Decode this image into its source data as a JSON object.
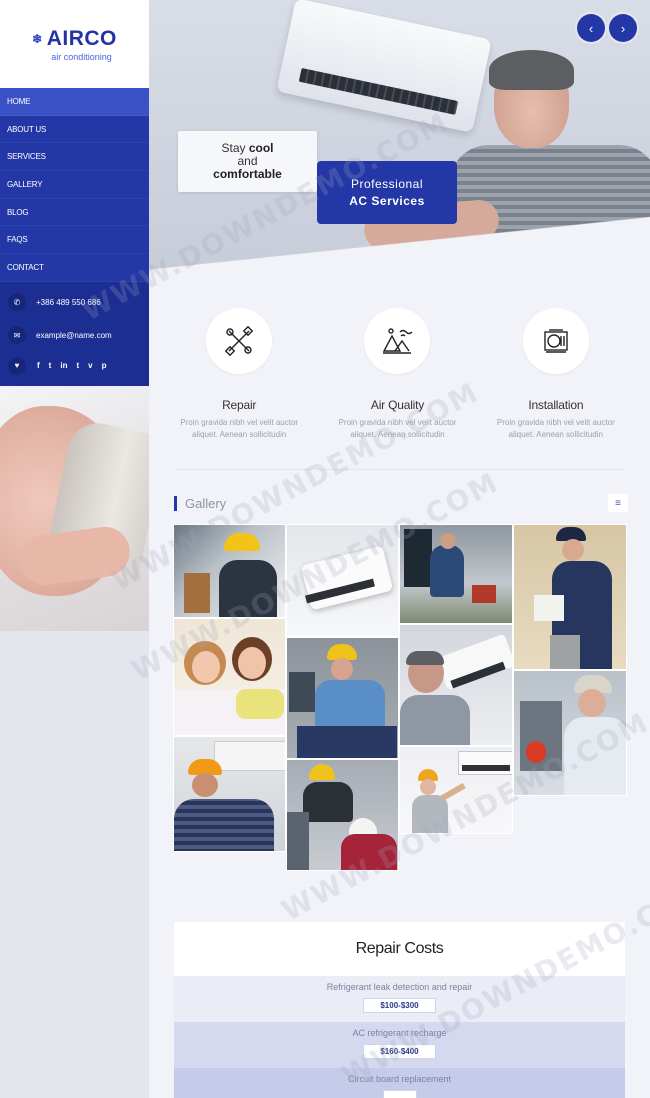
{
  "brand": {
    "name": "AIRCO",
    "tagline": "air conditioning",
    "accent": "#2338a6"
  },
  "nav": {
    "items": [
      "HOME",
      "ABOUT US",
      "SERVICES",
      "GALLERY",
      "BLOG",
      "FAQS",
      "CONTACT"
    ],
    "active": "HOME"
  },
  "contact": {
    "phone": "+386 489 550 686",
    "email": "example@name.com",
    "social_icons": [
      "heart-icon",
      "facebook-icon",
      "twitter-icon",
      "linkedin-icon",
      "tumblr-icon",
      "vimeo-icon",
      "pinterest-icon"
    ],
    "social_glyphs": [
      "f",
      "t",
      "in",
      "t",
      "v",
      "p"
    ]
  },
  "hero": {
    "note_line1": "Stay",
    "note_bold1": "cool",
    "note_line2": "and",
    "note_bold2": "comfortable",
    "cta_line1": "Professional",
    "cta_line2": "AC Services",
    "prev_label": "‹",
    "next_label": "›"
  },
  "features": [
    {
      "title": "Repair",
      "icon": "wrench-cross-icon",
      "text": "Proin gravida nibh vel velit auctor aliquet. Aenean sollicitudin"
    },
    {
      "title": "Air Quality",
      "icon": "air-quality-icon",
      "text": "Proin gravida nibh vel velit auctor aliquet. Aenean sollicitudin"
    },
    {
      "title": "Installation",
      "icon": "ac-unit-icon",
      "text": "Proin gravida nibh vel velit auctor aliquet. Aenean sollicitudin"
    }
  ],
  "gallery": {
    "title": "Gallery",
    "menu_icon": "menu-icon",
    "tiles": [
      "technician-wiring-photo",
      "wall-ac-unit-photo",
      "technician-kneeling-photo",
      "technician-clipboard-photo",
      "mother-daughter-photo",
      "technician-hardhat-photo",
      "technician-ac-repair-photo",
      "technician-outdoor-unit-photo",
      "technician-ceiling-unit-photo",
      "two-technicians-photo",
      "woman-ac-cleaning-photo"
    ]
  },
  "costs": {
    "title": "Repair Costs",
    "items": [
      {
        "name": "Refrigerant leak detection and repair",
        "price": "$100-$300"
      },
      {
        "name": "AC refrigerant recharge",
        "price": "$160-$400"
      },
      {
        "name": "Circuit board replacement",
        "price": ""
      }
    ]
  },
  "watermark": "WWW.DOWNDEMO.COM"
}
